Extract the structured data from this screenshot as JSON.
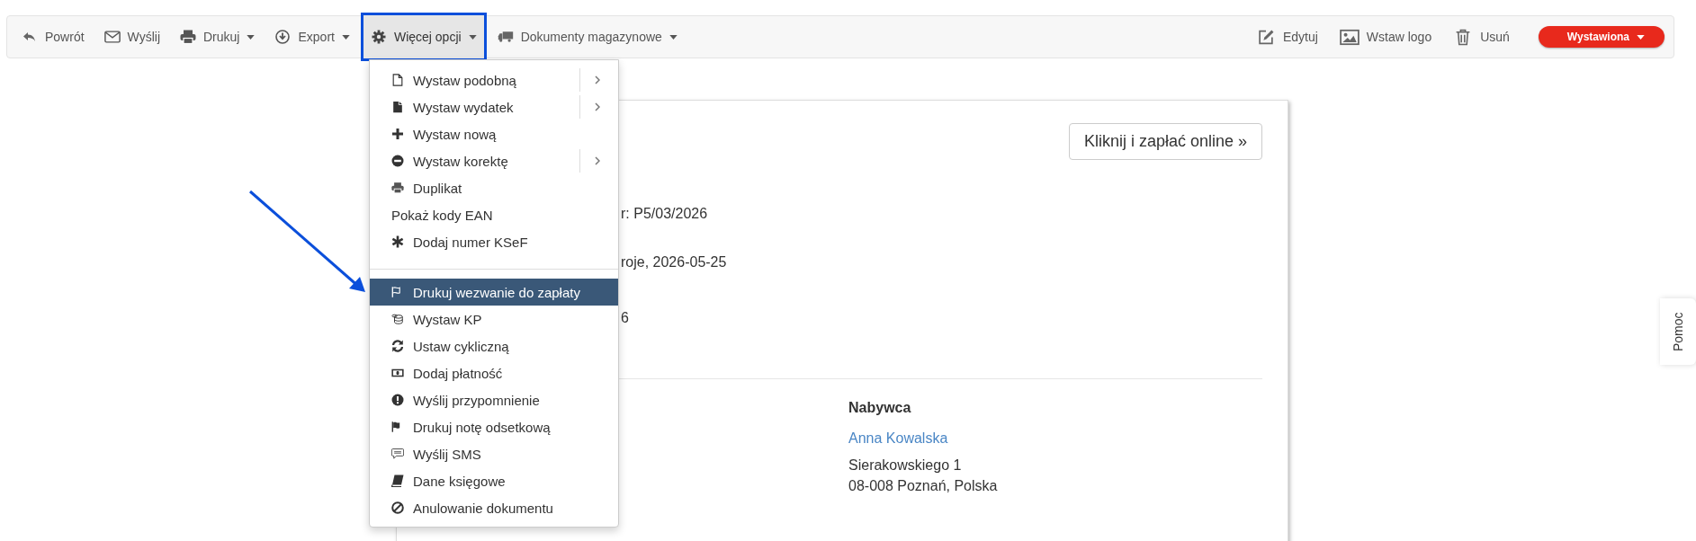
{
  "toolbar": {
    "left": [
      {
        "label": "Powrót",
        "dropdown": false,
        "active": false
      },
      {
        "label": "Wyślij",
        "dropdown": false,
        "active": false
      },
      {
        "label": "Drukuj",
        "dropdown": true,
        "active": false
      },
      {
        "label": "Export",
        "dropdown": true,
        "active": false
      },
      {
        "label": "Więcej opcji",
        "dropdown": true,
        "active": true
      },
      {
        "label": "Dokumenty magazynowe",
        "dropdown": true,
        "active": false
      }
    ],
    "right": [
      {
        "label": "Edytuj"
      },
      {
        "label": "Wstaw logo"
      },
      {
        "label": "Usuń"
      }
    ],
    "status": {
      "label": "Wystawiona",
      "color": "#e8291c"
    }
  },
  "menu": {
    "sections": [
      [
        {
          "label": "Wystaw podobną",
          "submenu": true,
          "selected": false
        },
        {
          "label": "Wystaw wydatek",
          "submenu": true,
          "selected": false
        },
        {
          "label": "Wystaw nową",
          "submenu": false,
          "selected": false
        },
        {
          "label": "Wystaw korektę",
          "submenu": true,
          "selected": false
        },
        {
          "label": "Duplikat",
          "submenu": false,
          "selected": false
        },
        {
          "label": "Pokaż kody EAN",
          "submenu": false,
          "selected": false
        },
        {
          "label": "Dodaj numer KSeF",
          "submenu": false,
          "selected": false
        }
      ],
      [
        {
          "label": "Drukuj wezwanie do zapłaty",
          "submenu": false,
          "selected": true
        },
        {
          "label": "Wystaw KP",
          "submenu": false,
          "selected": false
        },
        {
          "label": "Ustaw cykliczną",
          "submenu": false,
          "selected": false
        },
        {
          "label": "Dodaj płatność",
          "submenu": false,
          "selected": false
        },
        {
          "label": "Wyślij przypomnienie",
          "submenu": false,
          "selected": false
        },
        {
          "label": "Drukuj notę odsetkową",
          "submenu": false,
          "selected": false
        },
        {
          "label": "Wyślij SMS",
          "submenu": false,
          "selected": false
        },
        {
          "label": "Dane księgowe",
          "submenu": false,
          "selected": false
        },
        {
          "label": "Anulowanie dokumentu",
          "submenu": false,
          "selected": false
        }
      ]
    ]
  },
  "document": {
    "pay_button": "Kliknij i zapłać online »",
    "detail_fragments": [
      "r: P5/03/2026",
      "roje, 2026-05-25",
      "6"
    ],
    "buyer": {
      "heading": "Nabywca",
      "name": "Anna Kowalska",
      "address": [
        "Sierakowskiego 1",
        "08-008 Poznań, Polska"
      ]
    }
  },
  "help_tab": "Pomoc"
}
